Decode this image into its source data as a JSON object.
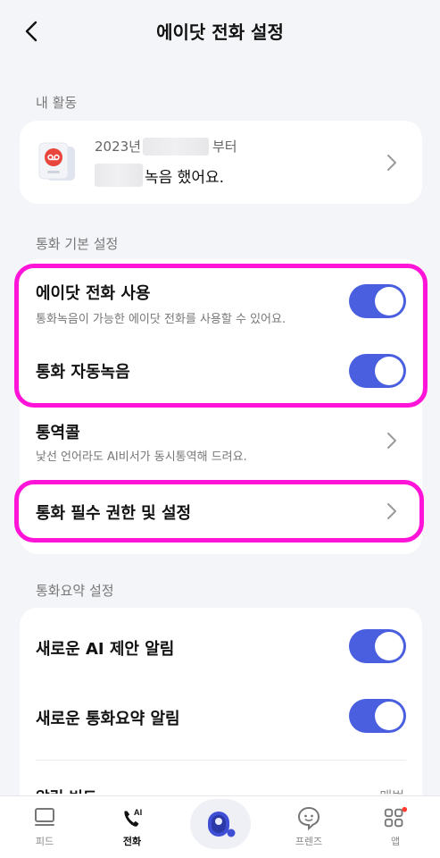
{
  "header": {
    "title": "에이닷 전화 설정"
  },
  "activity": {
    "section_label": "내 활동",
    "year_text": "2023년",
    "since_text": "부터",
    "recorded_text": "녹음 했어요."
  },
  "basic_settings": {
    "section_label": "통화 기본 설정",
    "adot_call": {
      "title": "에이닷 전화 사용",
      "subtitle": "통화녹음이 가능한 에이닷 전화를 사용할 수 있어요.",
      "enabled": true
    },
    "auto_record": {
      "title": "통화 자동녹음",
      "enabled": true
    },
    "interpret_call": {
      "title": "통역콜",
      "subtitle": "낯선 언어라도 AI비서가 동시통역해 드려요."
    },
    "permissions": {
      "title": "통화 필수 권한 및 설정"
    }
  },
  "summary_settings": {
    "section_label": "통화요약 설정",
    "ai_suggestion": {
      "title": "새로운 AI 제안 알림",
      "enabled": true
    },
    "summary_alert": {
      "title": "새로운 통화요약 알림",
      "enabled": true
    },
    "partial_row": {
      "title": "알림 빈도",
      "value": "매번"
    }
  },
  "tabbar": {
    "feed": "피드",
    "call": "전화",
    "friends": "프렌즈",
    "apps": "앱"
  },
  "colors": {
    "accent": "#4a5fe0",
    "highlight": "#ff14d8",
    "background": "#f4f5f8",
    "badge": "#ff3b30"
  }
}
